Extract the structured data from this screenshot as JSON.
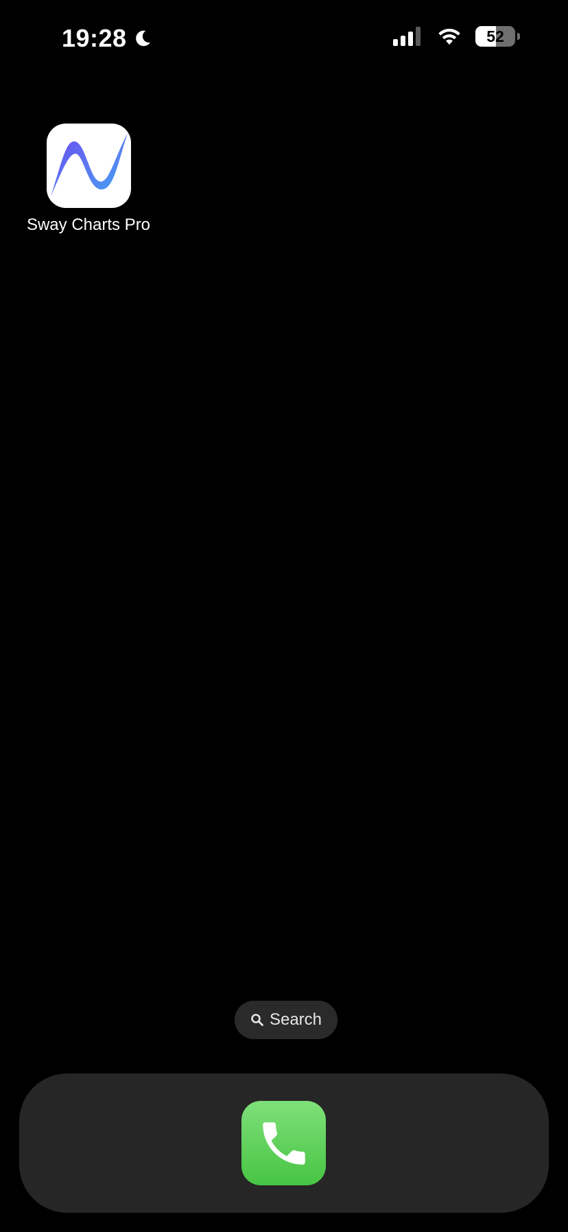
{
  "status_bar": {
    "time": "19:28",
    "focus_icon": "moon-icon",
    "signal_icon": "cellular-signal-icon",
    "wifi_icon": "wifi-icon",
    "battery_level": "52",
    "battery_fraction": 0.52
  },
  "home": {
    "apps": [
      {
        "label": "Sway Charts Pro",
        "icon": "sway-charts-pro-app-icon"
      }
    ],
    "search": {
      "label": "Search",
      "icon": "search-icon"
    }
  },
  "dock": {
    "apps": [
      {
        "label": "Phone",
        "icon": "phone-icon",
        "color": "#4cd964"
      }
    ]
  },
  "colors": {
    "background": "#000000",
    "dock": "#262626",
    "search_pill": "#2a2a2a"
  }
}
